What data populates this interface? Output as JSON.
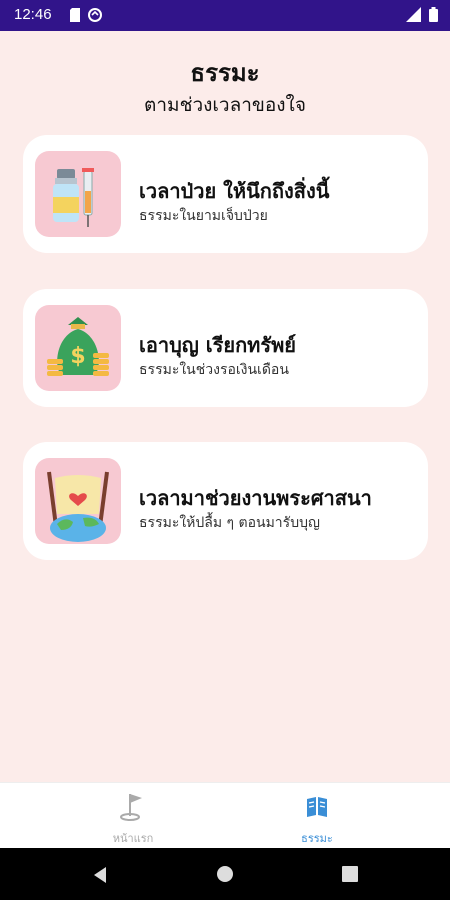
{
  "status_bar": {
    "time": "12:46",
    "bg_color": "#31148a"
  },
  "header": {
    "title": "ธรรมะ",
    "subtitle": "ตามช่วงเวลาของใจ"
  },
  "cards": [
    {
      "title": "เวลาป่วย ให้นึกถึงสิ่งนี้",
      "subtitle": "ธรรมะในยามเจ็บป่วย",
      "icon": "medicine-vial-syringe-icon"
    },
    {
      "title": "เอาบุญ เรียกทรัพย์",
      "subtitle": "ธรรมะในช่วงรอเงินเดือน",
      "icon": "money-bag-icon"
    },
    {
      "title": "เวลามาช่วยงานพระศาสนา",
      "subtitle": "ธรรมะให้ปลื้ม ๆ ตอนมารับบุญ",
      "icon": "world-heart-icon"
    }
  ],
  "bottom_nav": {
    "items": [
      {
        "label": "หน้าแรก",
        "icon": "golf-flag-icon",
        "active": false
      },
      {
        "label": "ธรรมะ",
        "icon": "open-book-icon",
        "active": true
      }
    ],
    "active_color": "#3a8ed6"
  },
  "colors": {
    "background": "#fcecea",
    "card": "#ffffff",
    "icon_bg": "#f7c9d2"
  }
}
